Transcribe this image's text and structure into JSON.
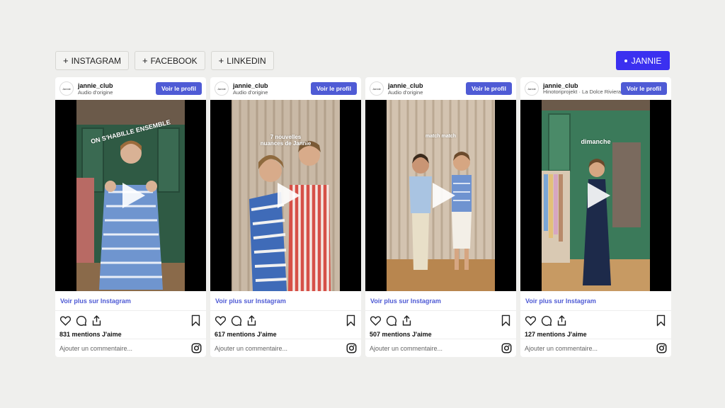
{
  "toolbar": {
    "instagram": "INSTAGRAM",
    "facebook": "FACEBOOK",
    "linkedin": "LINKEDIN",
    "plus": "+",
    "brand": "JANNIE"
  },
  "avatar_text": "Jannie",
  "posts": [
    {
      "username": "jannie_club",
      "audio": "Audio d'origine",
      "profile_button": "Voir le profil",
      "caption": "ON S'HABILLE ENSEMBLE",
      "more_link": "Voir plus sur Instagram",
      "likes": "831 mentions J'aime",
      "comment_placeholder": "Ajouter un commentaire..."
    },
    {
      "username": "jannie_club",
      "audio": "Audio d'origine",
      "profile_button": "Voir le profil",
      "caption": "7 nouvelles nuances de Jannie",
      "more_link": "Voir plus sur Instagram",
      "likes": "617 mentions J'aime",
      "comment_placeholder": "Ajouter un commentaire..."
    },
    {
      "username": "jannie_club",
      "audio": "Audio d'origine",
      "profile_button": "Voir le profil",
      "caption": "match match",
      "more_link": "Voir plus sur Instagram",
      "likes": "507 mentions J'aime",
      "comment_placeholder": "Ajouter un commentaire..."
    },
    {
      "username": "jannie_club",
      "audio": "Hinotoriprojekt · La Dolce Riviera",
      "profile_button": "Voir le profil",
      "caption": "dimanche",
      "more_link": "Voir plus sur Instagram",
      "likes": "127 mentions J'aime",
      "comment_placeholder": "Ajouter un commentaire..."
    }
  ],
  "colors": {
    "brand_button": "#3b30f0",
    "profile_button": "#4f5bd5",
    "link": "#4f5bd5",
    "page_background": "#efefed"
  },
  "icons": [
    "heart-icon",
    "comment-icon",
    "share-icon",
    "bookmark-icon",
    "instagram-icon",
    "play-icon"
  ]
}
